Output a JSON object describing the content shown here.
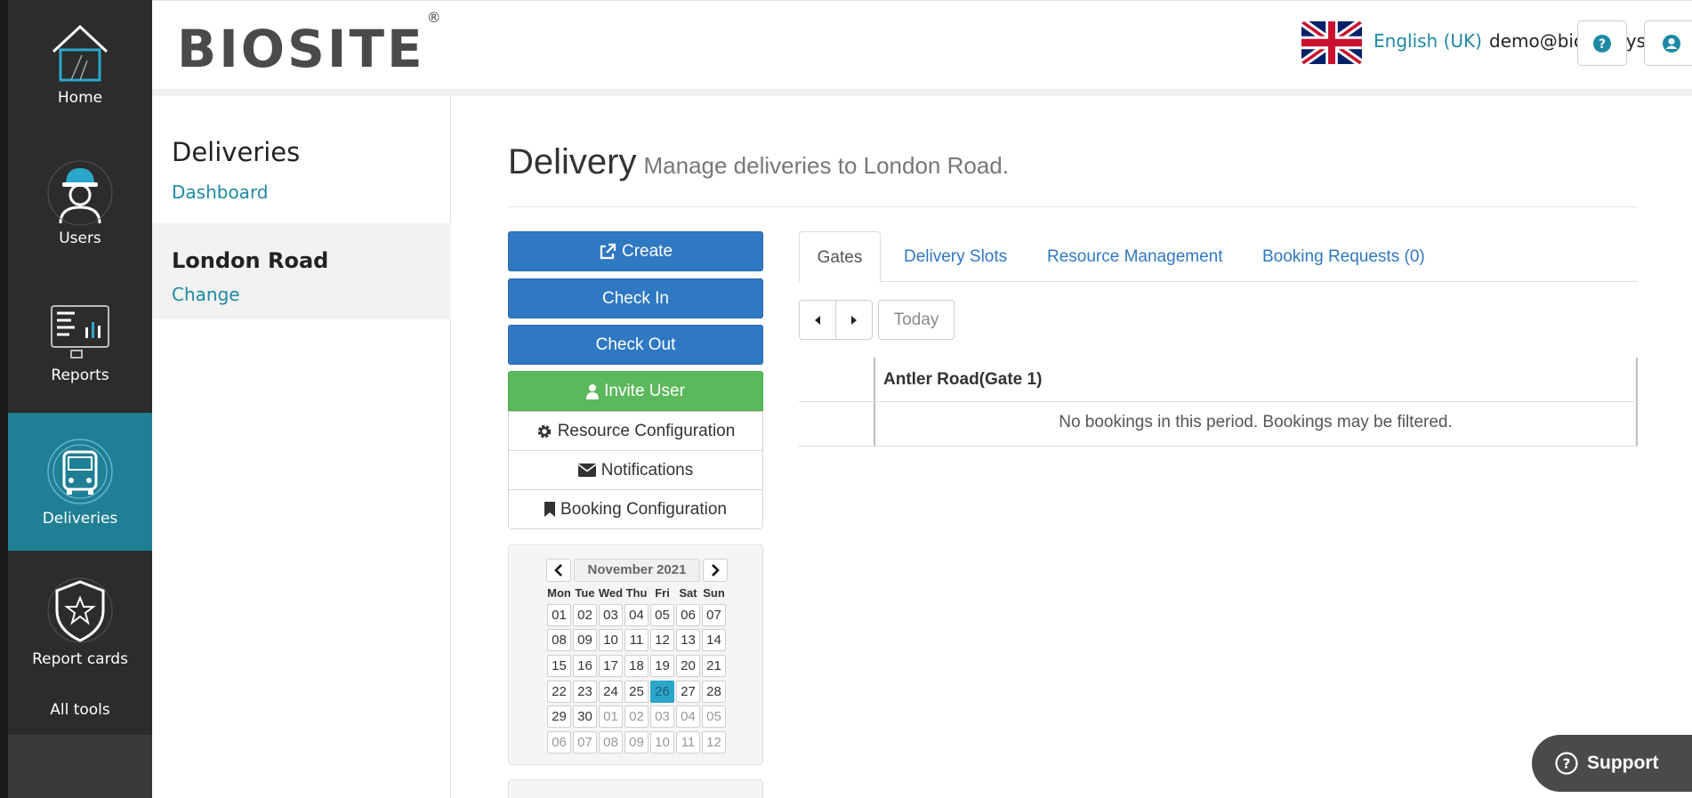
{
  "nav": {
    "items": [
      {
        "label": "Home",
        "icon": "house-icon"
      },
      {
        "label": "Users",
        "icon": "worker-icon"
      },
      {
        "label": "Reports",
        "icon": "reports-icon"
      },
      {
        "label": "Deliveries",
        "icon": "truck-icon"
      },
      {
        "label": "Report cards",
        "icon": "shield-star-icon"
      }
    ],
    "all_tools": "All tools",
    "active": "Deliveries"
  },
  "header": {
    "logo": "BIOSITE",
    "logo_mark": "®",
    "language": "English (UK)",
    "email": "demo@biositesystems.com"
  },
  "subnav": {
    "title": "Deliveries",
    "dashboard_link": "Dashboard",
    "site_name": "London Road",
    "change_link": "Change"
  },
  "page": {
    "title": "Delivery",
    "subtitle": "Manage deliveries to London Road."
  },
  "actions": {
    "create": "Create",
    "check_in": "Check In",
    "check_out": "Check Out",
    "invite_user": "Invite User",
    "list": [
      "Resource Configuration",
      "Notifications",
      "Booking Configuration"
    ]
  },
  "calendar": {
    "month": "November 2021",
    "dow": [
      "Mon",
      "Tue",
      "Wed",
      "Thu",
      "Fri",
      "Sat",
      "Sun"
    ],
    "weeks": [
      [
        "01",
        "02",
        "03",
        "04",
        "05",
        "06",
        "07"
      ],
      [
        "08",
        "09",
        "10",
        "11",
        "12",
        "13",
        "14"
      ],
      [
        "15",
        "16",
        "17",
        "18",
        "19",
        "20",
        "21"
      ],
      [
        "22",
        "23",
        "24",
        "25",
        "26",
        "27",
        "28"
      ],
      [
        "29",
        "30",
        "01",
        "02",
        "03",
        "04",
        "05"
      ],
      [
        "06",
        "07",
        "08",
        "09",
        "10",
        "11",
        "12"
      ]
    ],
    "today": "26"
  },
  "tabs": [
    "Gates",
    "Delivery Slots",
    "Resource Management",
    "Booking Requests (0)"
  ],
  "toolbar": {
    "today": "Today"
  },
  "gates": {
    "column": "Antler Road(Gate 1)",
    "empty": "No bookings in this period. Bookings may be filtered."
  },
  "support": "Support",
  "colors": {
    "nav_bg": "#2c2c2c",
    "nav_active": "#1f7f95",
    "primary": "#2f78c2",
    "success": "#5cb85c",
    "link": "#1d8aa5",
    "calendar_today": "#2ba6cb"
  }
}
